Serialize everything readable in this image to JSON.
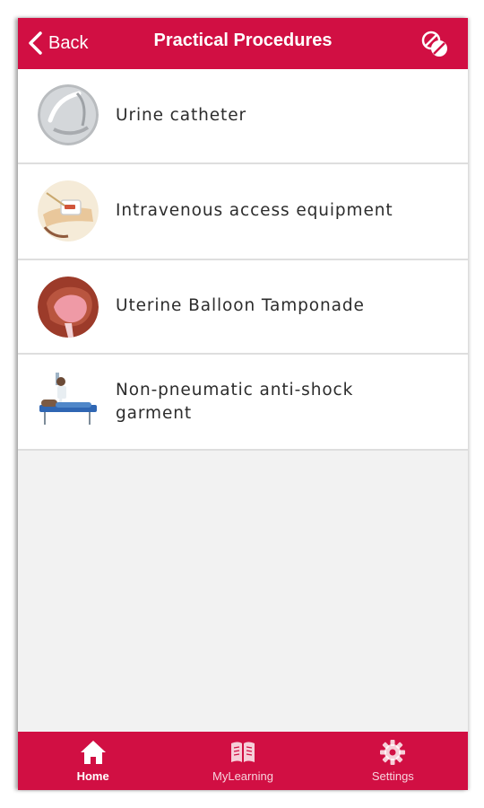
{
  "header": {
    "back_label": "Back",
    "title": "Practical Procedures",
    "icon": "pills-icon"
  },
  "items": [
    {
      "label": "Urine catheter",
      "icon": "urine-catheter-thumbnail"
    },
    {
      "label": "Intravenous access equipment",
      "icon": "iv-access-thumbnail"
    },
    {
      "label": "Uterine Balloon Tamponade",
      "icon": "uterine-balloon-thumbnail"
    },
    {
      "label_line1": "Non-pneumatic anti-shock",
      "label_line2": "garment",
      "icon": "anti-shock-garment-thumbnail"
    }
  ],
  "tabbar": {
    "tabs": [
      {
        "label": "Home",
        "icon": "home-icon",
        "active": true
      },
      {
        "label": "MyLearning",
        "icon": "book-icon",
        "active": false
      },
      {
        "label": "Settings",
        "icon": "gear-icon",
        "active": false
      }
    ]
  },
  "colors": {
    "brand": "#d10f43",
    "background": "#f2f2f2",
    "text": "#2c2c2c"
  }
}
